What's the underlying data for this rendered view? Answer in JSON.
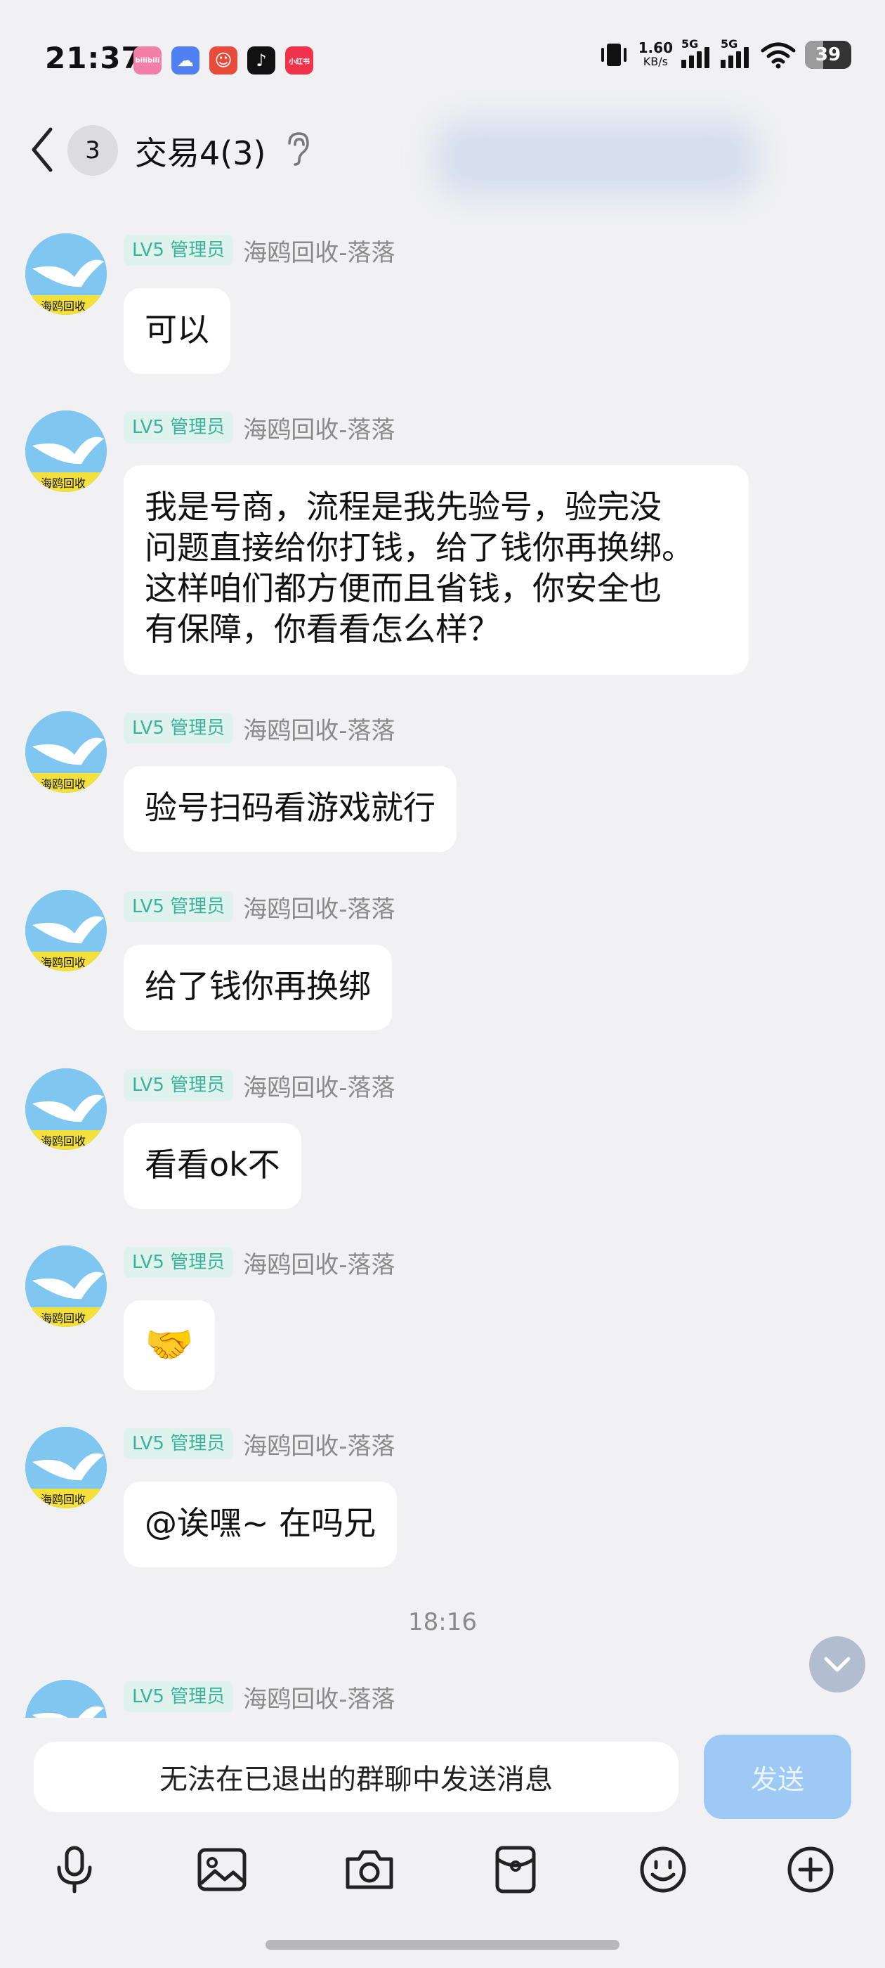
{
  "status": {
    "time": "21:37",
    "net_speed": "1.60",
    "net_unit": "KB/s",
    "sig1": "5G",
    "sig2": "5G",
    "battery": "39",
    "app_icons": [
      {
        "name": "bilibili-icon",
        "label": "bilibili",
        "color": "#f27fa6"
      },
      {
        "name": "baidu-cloud-icon",
        "label": "☁",
        "color": "#4f7ff0"
      },
      {
        "name": "game-app-icon",
        "label": "☺",
        "color": "#e84a3c"
      },
      {
        "name": "tiktok-icon",
        "label": "♪",
        "color": "#111111"
      },
      {
        "name": "xiaohongshu-icon",
        "label": "小红书",
        "color": "#f0334a"
      }
    ]
  },
  "header": {
    "badge_count": "3",
    "title": "交易4(3)"
  },
  "messages": [
    {
      "tag": "LV5 管理员",
      "sender": "海鸥回收-落落",
      "text": "可以"
    },
    {
      "tag": "LV5 管理员",
      "sender": "海鸥回收-落落",
      "lines": [
        "我是号商，流程是我先验号，验完没",
        "问题直接给你打钱，给了钱你再换绑。",
        "这样咱们都方便而且省钱，你安全也",
        "有保障，你看看怎么样？"
      ]
    },
    {
      "tag": "LV5 管理员",
      "sender": "海鸥回收-落落",
      "text": "验号扫码看游戏就行"
    },
    {
      "tag": "LV5 管理员",
      "sender": "海鸥回收-落落",
      "text": "给了钱你再换绑"
    },
    {
      "tag": "LV5 管理员",
      "sender": "海鸥回收-落落",
      "text": "看看ok不"
    },
    {
      "tag": "LV5 管理员",
      "sender": "海鸥回收-落落",
      "text": "🤝"
    },
    {
      "tag": "LV5 管理员",
      "sender": "海鸥回收-落落",
      "text": "@诶嘿~ 在吗兄"
    },
    {
      "tag": "LV5 管理员",
      "sender": "海鸥回收-落落"
    }
  ],
  "avatar_text": "海鸥回收",
  "timestamp": "18:16",
  "input": {
    "placeholder": "无法在已退出的群聊中发送消息",
    "send_label": "发送"
  },
  "toolbar": [
    "mic-icon",
    "image-icon",
    "camera-icon",
    "red-packet-icon",
    "emoji-icon",
    "plus-icon"
  ]
}
